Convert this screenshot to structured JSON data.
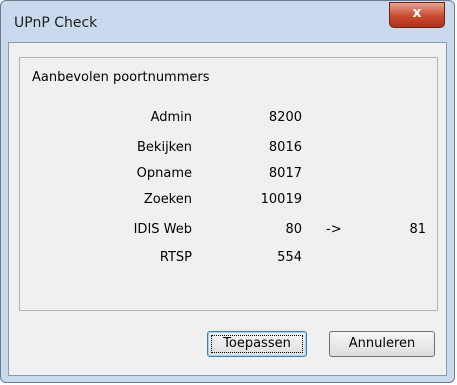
{
  "window": {
    "title": "UPnP Check"
  },
  "titlebar": {
    "close_glyph": "x"
  },
  "group": {
    "title": "Aanbevolen poortnummers"
  },
  "ports": [
    {
      "label": "Admin",
      "value": "8200",
      "arrow": "",
      "external": ""
    },
    {
      "label": "Bekijken",
      "value": "8016",
      "arrow": "",
      "external": ""
    },
    {
      "label": "Opname",
      "value": "8017",
      "arrow": "",
      "external": ""
    },
    {
      "label": "Zoeken",
      "value": "10019",
      "arrow": "",
      "external": ""
    },
    {
      "label": "IDIS Web",
      "value": "80",
      "arrow": "->",
      "external": "81"
    },
    {
      "label": "RTSP",
      "value": "554",
      "arrow": "",
      "external": ""
    }
  ],
  "buttons": {
    "apply": "Toepassen",
    "cancel": "Annuleren"
  }
}
